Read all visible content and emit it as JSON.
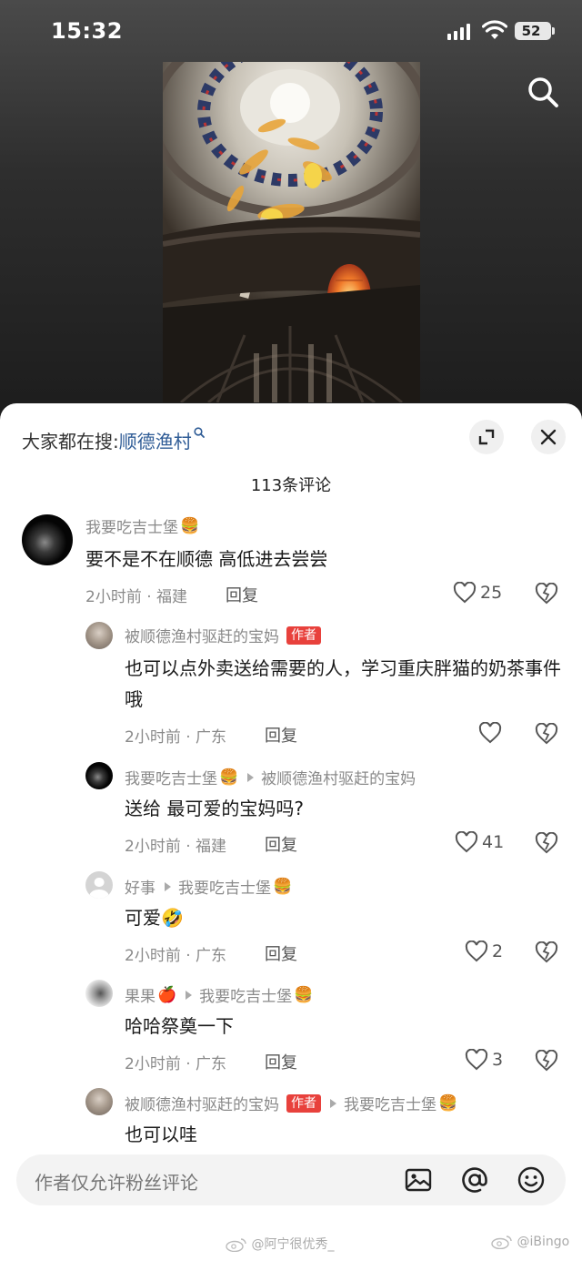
{
  "status": {
    "time": "15:32",
    "battery": "52"
  },
  "header": {
    "hot_search_label": "大家都在搜:",
    "hot_search_keyword": "顺德渔村"
  },
  "comments_count": "113条评论",
  "comments": [
    {
      "user": "我要吃吉士堡",
      "user_emoji": "🍔",
      "text": "要不是不在顺德 高低进去尝尝",
      "time": "2小时前 · 福建",
      "reply": "回复",
      "likes": "25"
    },
    {
      "user": "被顺德渔村驱赶的宝妈",
      "author_tag": "作者",
      "text": "也可以点外卖送给需要的人，学习重庆胖猫的奶茶事件哦",
      "time": "2小时前 · 广东",
      "reply": "回复",
      "likes": ""
    },
    {
      "user": "我要吃吉士堡",
      "user_emoji": "🍔",
      "reply_to": "被顺德渔村驱赶的宝妈",
      "text": "送给 最可爱的宝妈吗?",
      "time": "2小时前 · 福建",
      "reply": "回复",
      "likes": "41"
    },
    {
      "user": "好事",
      "reply_to": "我要吃吉士堡",
      "reply_to_emoji": "🍔",
      "text": "可爱",
      "text_emoji": "🤣",
      "time": "2小时前 · 广东",
      "reply": "回复",
      "likes": "2"
    },
    {
      "user": "果果",
      "user_emoji": "🍎",
      "reply_to": "我要吃吉士堡",
      "reply_to_emoji": "🍔",
      "text": "哈哈祭奠一下",
      "time": "2小时前 · 广东",
      "reply": "回复",
      "likes": "3"
    },
    {
      "user": "被顺德渔村驱赶的宝妈",
      "author_tag": "作者",
      "reply_to": "我要吃吉士堡",
      "reply_to_emoji": "🍔",
      "text": "也可以哇"
    }
  ],
  "input": {
    "placeholder": "作者仅允许粉丝评论"
  },
  "watermarks": {
    "left": "@阿宁很优秀_",
    "right": "@iBingo"
  },
  "icons": [
    "search-icon",
    "expand-icon",
    "close-icon",
    "heart-icon",
    "dislike-icon",
    "image-icon",
    "at-icon",
    "emoji-icon",
    "weibo-icon"
  ],
  "colors": {
    "accent_keyword": "#2f5c96",
    "author_tag": "#e8413c"
  }
}
